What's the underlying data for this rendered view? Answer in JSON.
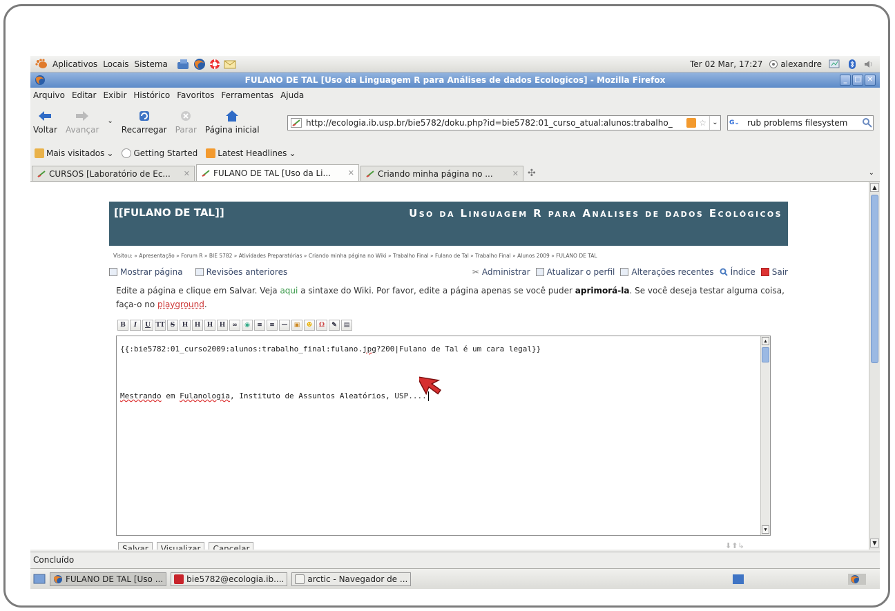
{
  "gnome_panel": {
    "menus": [
      "Aplicativos",
      "Locais",
      "Sistema"
    ],
    "datetime": "Ter 02 Mar, 17:27",
    "user": "alexandre"
  },
  "window": {
    "title": "FULANO DE TAL [Uso da Linguagem R para Análises de dados Ecologicos] - Mozilla Firefox"
  },
  "menubar": {
    "items": [
      "Arquivo",
      "Editar",
      "Exibir",
      "Histórico",
      "Favoritos",
      "Ferramentas",
      "Ajuda"
    ]
  },
  "navbar": {
    "back": "Voltar",
    "forward": "Avançar",
    "reload": "Recarregar",
    "stop": "Parar",
    "home": "Página inicial",
    "url": "http://ecologia.ib.usp.br/bie5782/doku.php?id=bie5782:01_curso_atual:alunos:trabalho_",
    "search": "rub problems filesystem"
  },
  "bookmarks": [
    "Mais visitados",
    "Getting Started",
    "Latest Headlines"
  ],
  "tabs": [
    {
      "label": "CURSOS [Laboratório de Ec...",
      "active": false
    },
    {
      "label": "FULANO DE TAL [Uso da Li...",
      "active": true
    },
    {
      "label": "Criando minha página no ...",
      "active": false
    }
  ],
  "wiki": {
    "page_title": "[[FULANO DE TAL]]",
    "site_title": "Uso da Linguagem R para Análises de dados Ecológicos",
    "breadcrumb": "Visitou: » Apresentação » Forum R » BIE 5782 » Atividades Preparatórias » Criando minha página no Wiki » Trabalho Final » Fulano de Tal » Trabalho Final » Alunos 2009 » FULANO DE TAL",
    "actions_left": [
      "Mostrar página",
      "Revisões anteriores"
    ],
    "actions_right": [
      "Administrar",
      "Atualizar o perfil",
      "Alterações recentes",
      "Índice",
      "Sair"
    ],
    "intro_1": "Edite a página e clique em Salvar. Veja ",
    "intro_link_aqui": "aqui",
    "intro_2": " a sintaxe do Wiki. Por favor, edite a página apenas se você puder ",
    "intro_bold": "aprimorá-la",
    "intro_3": ". Se você deseja testar alguma coisa, faça-o no ",
    "intro_link_playground": "playground",
    "intro_4": ".",
    "editor_line1_a": "{{:bie5782:01_curso2009:alunos:trabalho_final:fulano.",
    "editor_line1_b": "jpg",
    "editor_line1_c": "?200|Fulano de Tal é um cara legal}}",
    "editor_line2_a": "Mestrando",
    "editor_line2_b": " em ",
    "editor_line2_c": "Fulanologia",
    "editor_line2_d": ", Instituto de Assuntos Aleatórios, USP....",
    "buttons": [
      "Salvar",
      "Visualizar",
      "Cancelar"
    ]
  },
  "status": "Concluído",
  "taskbar": [
    {
      "label": "FULANO DE TAL [Uso ...",
      "active": true
    },
    {
      "label": "bie5782@ecologia.ib....",
      "active": false
    },
    {
      "label": "arctic - Navegador de ...",
      "active": false
    }
  ],
  "colors": {
    "wiki_header": "#3c5f70",
    "titlebar": "#5d8bc9",
    "link_green": "#3a9a4a",
    "link_red": "#cc3333"
  }
}
